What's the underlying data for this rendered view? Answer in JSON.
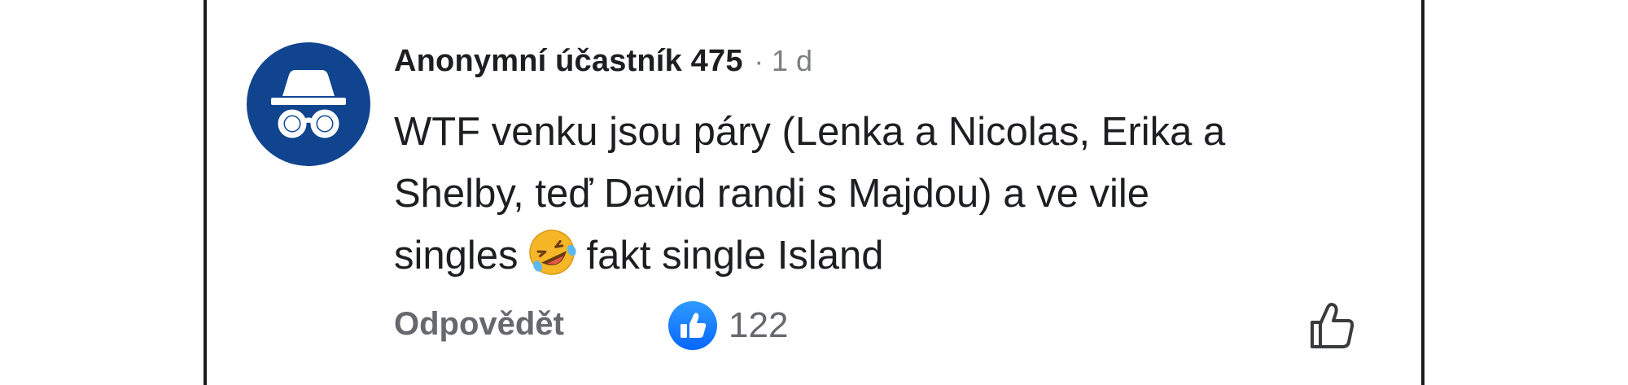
{
  "comment": {
    "author": "Anonymní účastník 475",
    "separator": "·",
    "time": "1 d",
    "text_lines": [
      "WTF venku jsou páry (Lenka a Nicolas, Erika a",
      "Shelby, teď David randi s Majdou) a ve vile"
    ],
    "text_last_before_emoji": "singles",
    "text_last_after_emoji": "fakt single Island",
    "emoji": "rolling-on-floor-laughing-icon"
  },
  "actions": {
    "reply_label": "Odpovědět",
    "reaction_count": "122",
    "reaction_icon": "thumbs-up-icon",
    "like_icon": "thumbs-up-outline-icon"
  },
  "avatar": {
    "icon": "incognito-icon",
    "color": "#10448f"
  },
  "colors": {
    "author": "#1c1e21",
    "muted": "#65686d",
    "reaction_blue": "#1877f2"
  }
}
